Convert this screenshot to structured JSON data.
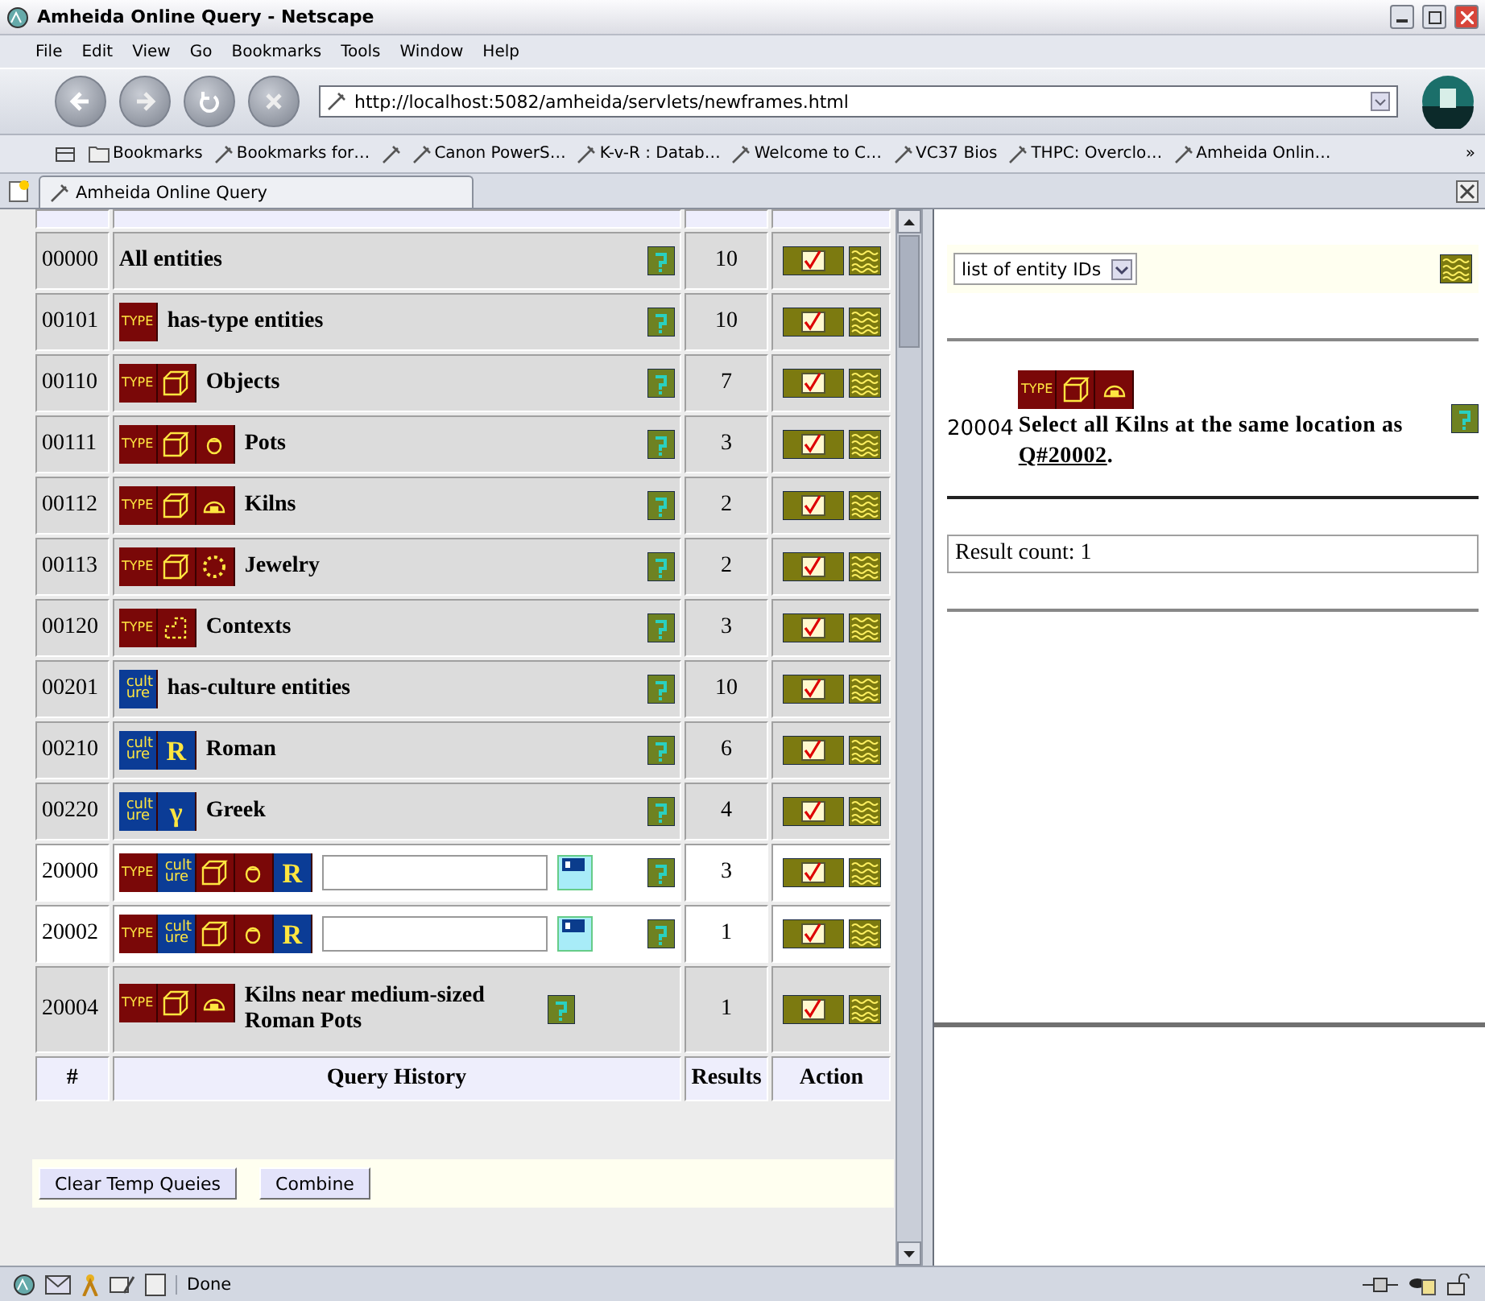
{
  "window": {
    "title": "Amheida Online Query - Netscape"
  },
  "menu": [
    "File",
    "Edit",
    "View",
    "Go",
    "Bookmarks",
    "Tools",
    "Window",
    "Help"
  ],
  "address": {
    "url": "http://localhost:5082/amheida/servlets/newframes.html"
  },
  "bookmarks": [
    {
      "kind": "folder",
      "label": "Bookmarks"
    },
    {
      "kind": "link",
      "label": "Bookmarks for…"
    },
    {
      "kind": "link-icon"
    },
    {
      "kind": "link",
      "label": "Canon PowerS…"
    },
    {
      "kind": "link",
      "label": "K-v-R : Datab…"
    },
    {
      "kind": "link",
      "label": "Welcome to C…"
    },
    {
      "kind": "link",
      "label": "VC37 Bios"
    },
    {
      "kind": "link",
      "label": "THPC: Overclo…"
    },
    {
      "kind": "link",
      "label": "Amheida Onlin…"
    }
  ],
  "bookmarks_more": "»",
  "tab": {
    "title": "Amheida Online Query"
  },
  "query_table": {
    "columns": [
      "#",
      "Query History",
      "Results",
      "Action"
    ],
    "rows": [
      {
        "id": "00000",
        "kind": "entry",
        "badges": [],
        "label": "All entities",
        "results": "10"
      },
      {
        "id": "00101",
        "kind": "entry",
        "badges": [
          {
            "kind": "type",
            "text": "TYPE"
          }
        ],
        "label": "has-type entities",
        "results": "10"
      },
      {
        "id": "00110",
        "kind": "entry",
        "badges": [
          {
            "kind": "type",
            "text": "TYPE"
          },
          {
            "kind": "object"
          }
        ],
        "label": "Objects",
        "results": "7"
      },
      {
        "id": "00111",
        "kind": "entry",
        "badges": [
          {
            "kind": "type",
            "text": "TYPE"
          },
          {
            "kind": "object"
          },
          {
            "kind": "pot"
          }
        ],
        "label": "Pots",
        "results": "3"
      },
      {
        "id": "00112",
        "kind": "entry",
        "badges": [
          {
            "kind": "type",
            "text": "TYPE"
          },
          {
            "kind": "object"
          },
          {
            "kind": "kiln"
          }
        ],
        "label": "Kilns",
        "results": "2"
      },
      {
        "id": "00113",
        "kind": "entry",
        "badges": [
          {
            "kind": "type",
            "text": "TYPE"
          },
          {
            "kind": "object"
          },
          {
            "kind": "jewelry"
          }
        ],
        "label": "Jewelry",
        "results": "2"
      },
      {
        "id": "00120",
        "kind": "entry",
        "badges": [
          {
            "kind": "type",
            "text": "TYPE"
          },
          {
            "kind": "context"
          }
        ],
        "label": "Contexts",
        "results": "3"
      },
      {
        "id": "00201",
        "kind": "entry",
        "badges": [
          {
            "kind": "culture",
            "text": "cult ure"
          }
        ],
        "label": "has-culture entities",
        "results": "10"
      },
      {
        "id": "00210",
        "kind": "entry",
        "badges": [
          {
            "kind": "culture",
            "text": "cult ure"
          },
          {
            "kind": "letter",
            "text": "R"
          }
        ],
        "label": "Roman",
        "results": "6"
      },
      {
        "id": "00220",
        "kind": "entry",
        "badges": [
          {
            "kind": "culture",
            "text": "cult ure"
          },
          {
            "kind": "letter",
            "text": "γ"
          }
        ],
        "label": "Greek",
        "results": "4"
      },
      {
        "id": "20000",
        "kind": "field",
        "badges": [
          {
            "kind": "type",
            "text": "TYPE"
          },
          {
            "kind": "culture",
            "text": "cult ure"
          },
          {
            "kind": "object"
          },
          {
            "kind": "pot"
          },
          {
            "kind": "letter",
            "text": "R"
          }
        ],
        "results": "3"
      },
      {
        "id": "20002",
        "kind": "field",
        "badges": [
          {
            "kind": "type",
            "text": "TYPE"
          },
          {
            "kind": "culture",
            "text": "cult ure"
          },
          {
            "kind": "object"
          },
          {
            "kind": "pot"
          },
          {
            "kind": "letter",
            "text": "R"
          }
        ],
        "results": "1"
      },
      {
        "id": "20004",
        "kind": "entry",
        "badges": [
          {
            "kind": "type",
            "text": "TYPE"
          },
          {
            "kind": "object"
          },
          {
            "kind": "kiln"
          }
        ],
        "label": "Kilns near medium-sized Roman Pots",
        "results": "1"
      }
    ]
  },
  "buttons": [
    "Clear Temp Queies",
    "Combine"
  ],
  "result_panel": {
    "format": "list of entity IDs",
    "query": {
      "id": "20004",
      "badges": [
        {
          "kind": "type",
          "text": "TYPE"
        },
        {
          "kind": "object"
        },
        {
          "kind": "kiln"
        }
      ],
      "text": "Select all Kilns at the same location as",
      "link": "Q#20002",
      "end": "."
    },
    "count": "Result count: 1"
  },
  "status_bar": {
    "text": "Done"
  }
}
